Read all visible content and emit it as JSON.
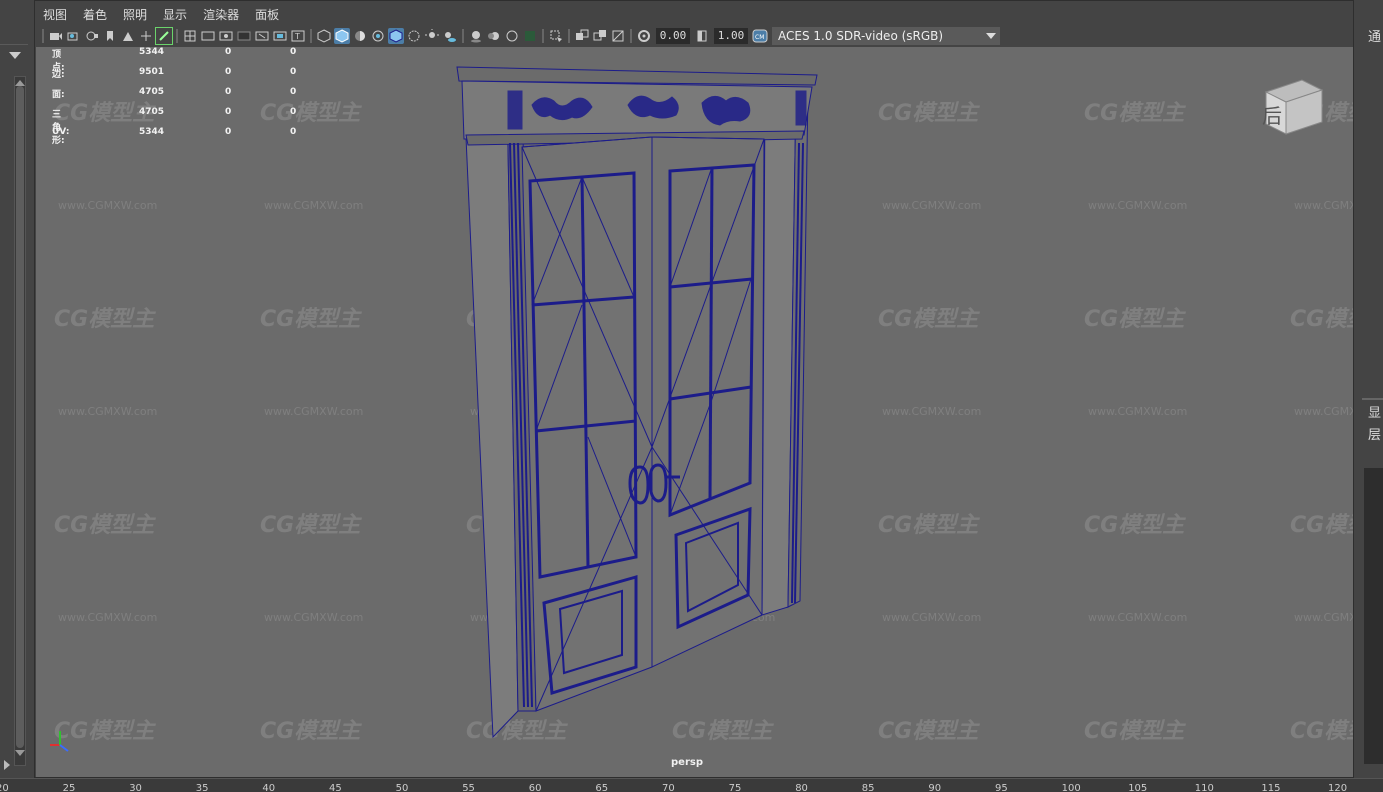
{
  "menu": [
    "视图",
    "着色",
    "照明",
    "显示",
    "渲染器",
    "面板"
  ],
  "toolbar": {
    "exposure_value": "0.00",
    "gamma_value": "1.00",
    "color_space": "ACES 1.0 SDR-video (sRGB)"
  },
  "hud": [
    {
      "label": "顶点:",
      "v1": "5344",
      "v2": "0",
      "v3": "0"
    },
    {
      "label": "边:",
      "v1": "9501",
      "v2": "0",
      "v3": "0"
    },
    {
      "label": "面:",
      "v1": "4705",
      "v2": "0",
      "v3": "0"
    },
    {
      "label": "三角形:",
      "v1": "4705",
      "v2": "0",
      "v3": "0"
    },
    {
      "label": "UV:",
      "v1": "5344",
      "v2": "0",
      "v3": "0"
    }
  ],
  "viewport": {
    "camera_label": "persp",
    "viewcube_label": "后",
    "watermark_logo": "CG模型主",
    "watermark_url": "www.CGMXW.com"
  },
  "right_panel": {
    "top_text": "通",
    "mid_text_1": "显",
    "mid_text_2": "层"
  },
  "ruler_ticks": [
    "20",
    "25",
    "30",
    "35",
    "40",
    "45",
    "50",
    "55",
    "60",
    "65",
    "70",
    "75",
    "80",
    "85",
    "90",
    "95",
    "100",
    "105",
    "110",
    "115",
    "120"
  ],
  "colors": {
    "wireframe": "#1c1c8a",
    "viewport_bg": "#6b6b6b",
    "active_button": "#4c7ea8"
  }
}
